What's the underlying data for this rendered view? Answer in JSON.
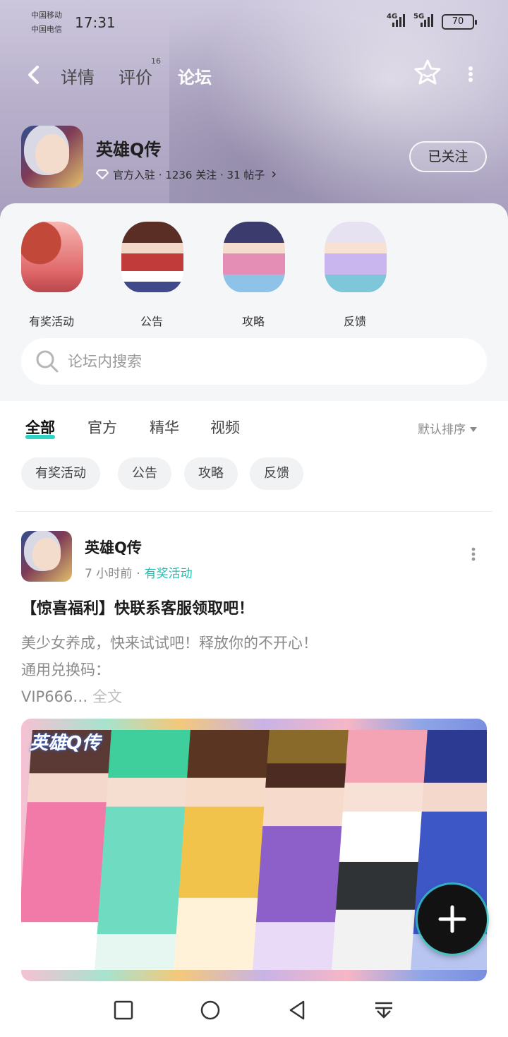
{
  "status_bar": {
    "carrier_1": "中国移动",
    "carrier_2": "中国电信",
    "time": "17:31",
    "network_1": "4G",
    "network_2": "5G",
    "battery": "70"
  },
  "nav": {
    "tabs": [
      {
        "label": "详情"
      },
      {
        "label": "评价",
        "badge": "16"
      },
      {
        "label": "论坛",
        "active": true
      }
    ]
  },
  "app": {
    "name": "英雄Q传",
    "meta": "官方入驻 · 1236 关注 · 31 帖子",
    "meta_chevron": "›",
    "follow_label": "已关注"
  },
  "categories": [
    {
      "label": "有奖活动",
      "icon": "event-character-icon"
    },
    {
      "label": "公告",
      "icon": "announcement-character-icon"
    },
    {
      "label": "攻略",
      "icon": "guide-character-icon"
    },
    {
      "label": "反馈",
      "icon": "feedback-character-icon"
    }
  ],
  "search": {
    "placeholder": "论坛内搜索"
  },
  "feed": {
    "tabs": [
      "全部",
      "官方",
      "精华",
      "视频"
    ],
    "active_tab": "全部",
    "sort_label": "默认排序",
    "chips": [
      "有奖活动",
      "公告",
      "攻略",
      "反馈"
    ]
  },
  "post": {
    "author": "英雄Q传",
    "time": "7 小时前",
    "tag": "有奖活动",
    "title": "【惊喜福利】快联系客服领取吧！",
    "body_line_1": "美少女养成，快来试试吧！释放你的不开心！",
    "body_line_2": "通用兑换码：",
    "body_line_3": "VIP666…",
    "full_text": "全文",
    "banner_logo": "英雄Q传"
  },
  "colors": {
    "accent": "#2ed3c6",
    "tag": "#1fbfb2"
  }
}
